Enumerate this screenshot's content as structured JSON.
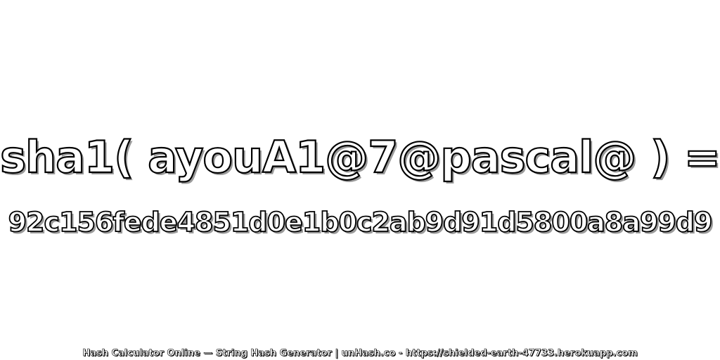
{
  "headline": "sha1( ayouA1@7@pascal@ ) =",
  "hash_value": "92c156fede4851d0e1b0c2ab9d91d5800a8a99d9",
  "footer": "Hash Calculator Online — String Hash Generator | unHash.co - https://shielded-earth-47733.herokuapp.com",
  "colors": {
    "background": "#ffffff",
    "text_fill": "#ffffff",
    "text_outline": "#000000",
    "text_shadow": "#9a9a9a"
  }
}
